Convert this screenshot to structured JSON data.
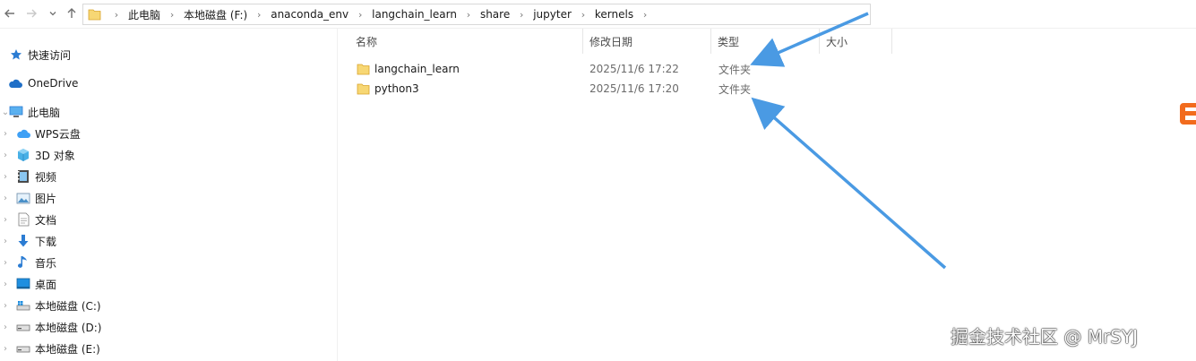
{
  "window": {
    "breadcrumbs": [
      "此电脑",
      "本地磁盘 (F:)",
      "anaconda_env",
      "langchain_learn",
      "share",
      "jupyter",
      "kernels"
    ]
  },
  "navigation": {
    "back_icon": "arrow-left-icon",
    "forward_icon": "arrow-right-icon",
    "recent_icon": "chevron-down-icon",
    "up_icon": "arrow-up-icon"
  },
  "sidebar": {
    "items": [
      {
        "label": "快速访问",
        "icon": "star-icon"
      },
      {
        "label": "OneDrive",
        "icon": "cloud-icon"
      },
      {
        "label": "此电脑",
        "icon": "pc-icon"
      },
      {
        "label": "WPS云盘",
        "icon": "wps-cloud-icon"
      },
      {
        "label": "3D 对象",
        "icon": "3d-objects-icon"
      },
      {
        "label": "视频",
        "icon": "video-icon"
      },
      {
        "label": "图片",
        "icon": "pictures-icon"
      },
      {
        "label": "文档",
        "icon": "documents-icon"
      },
      {
        "label": "下载",
        "icon": "download-icon"
      },
      {
        "label": "音乐",
        "icon": "music-icon"
      },
      {
        "label": "桌面",
        "icon": "desktop-icon"
      },
      {
        "label": "本地磁盘 (C:)",
        "icon": "drive-icon"
      },
      {
        "label": "本地磁盘 (D:)",
        "icon": "drive-icon"
      },
      {
        "label": "本地磁盘 (E:)",
        "icon": "drive-icon"
      }
    ]
  },
  "main": {
    "columns": {
      "name": "名称",
      "modified": "修改日期",
      "type": "类型",
      "size": "大小"
    },
    "rows": [
      {
        "name": "langchain_learn",
        "modified": "2025/11/6 17:22",
        "type": "文件夹"
      },
      {
        "name": "python3",
        "modified": "2025/11/6 17:20",
        "type": "文件夹"
      }
    ]
  },
  "watermark": {
    "text": "掘金技术社区 @ MrSYJ"
  },
  "colors": {
    "folder": "#f7c948",
    "folder_dark": "#e6a817",
    "accent_blue": "#3b8fd9",
    "arrow": "#4a9ae3",
    "logo_orange": "#f26b1d"
  }
}
